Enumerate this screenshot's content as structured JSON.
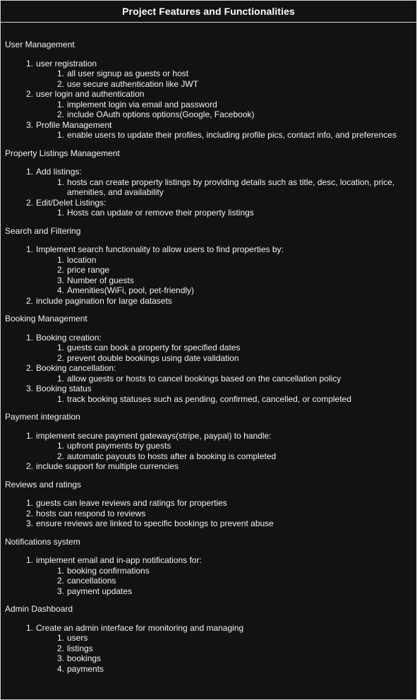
{
  "title": "Project Features and Functionalities",
  "sections": [
    {
      "heading": "User Management",
      "items": [
        {
          "text": "user registration",
          "sub": [
            "all user signup as guests or host",
            "use secure authentication like JWT"
          ]
        },
        {
          "text": "user login and authentication",
          "sub": [
            "implement login via email and password",
            "include OAuth options options(Google, Facebook)"
          ]
        },
        {
          "text": "Profile Management",
          "sub": [
            "enable users to update their profiles, including profile pics, contact info, and preferences"
          ]
        }
      ]
    },
    {
      "heading": "Property Listings Management",
      "items": [
        {
          "text": "Add listings:",
          "sub": [
            "hosts can create property listings by providing details such as title, desc, location, price, amenities, and availability"
          ]
        },
        {
          "text": "Edit/Delet Listings:",
          "sub": [
            "Hosts can update or remove their property listings"
          ]
        }
      ]
    },
    {
      "heading": "Search and Filtering",
      "items": [
        {
          "text": "Implement search functionality to allow users to find properties by:",
          "sub": [
            "location",
            "price range",
            "Number of guests",
            "Amenities(WiFi, pool, pet-friendly)"
          ]
        },
        {
          "text": "include pagination for large datasets",
          "sub": []
        }
      ]
    },
    {
      "heading": "Booking Management",
      "items": [
        {
          "text": "Booking creation:",
          "sub": [
            "guests can book a property for specified dates",
            "prevent double bookings using date validation"
          ]
        },
        {
          "text": "Booking cancellation:",
          "sub": [
            "allow guests or hosts to cancel bookings based on the cancellation policy"
          ]
        },
        {
          "text": "Booking status",
          "sub": [
            "track booking statuses such as pending, confirmed, cancelled, or completed"
          ]
        }
      ]
    },
    {
      "heading": "Payment integration",
      "items": [
        {
          "text": "implement secure payment gateways(stripe, paypal) to handle:",
          "sub": [
            "upfront payments by guests",
            "automatic payouts to hosts after a booking is completed"
          ]
        },
        {
          "text": "include support for multiple currencies",
          "sub": []
        }
      ]
    },
    {
      "heading": "Reviews and ratings",
      "items": [
        {
          "text": "guests can leave reviews and ratings for properties",
          "sub": []
        },
        {
          "text": "hosts can respond to reviews",
          "sub": []
        },
        {
          "text": "ensure reviews are linked to specific bookings to prevent abuse",
          "sub": []
        }
      ]
    },
    {
      "heading": "Notifications system",
      "items": [
        {
          "text": "implement email and in-app notifications for:",
          "sub": [
            "booking confirmations",
            "cancellations",
            "payment updates"
          ]
        }
      ]
    },
    {
      "heading": "Admin Dashboard",
      "items": [
        {
          "text": "Create an admin interface for monitoring and managing",
          "sub": [
            "users",
            "listings",
            "bookings",
            "payments"
          ]
        }
      ]
    }
  ]
}
